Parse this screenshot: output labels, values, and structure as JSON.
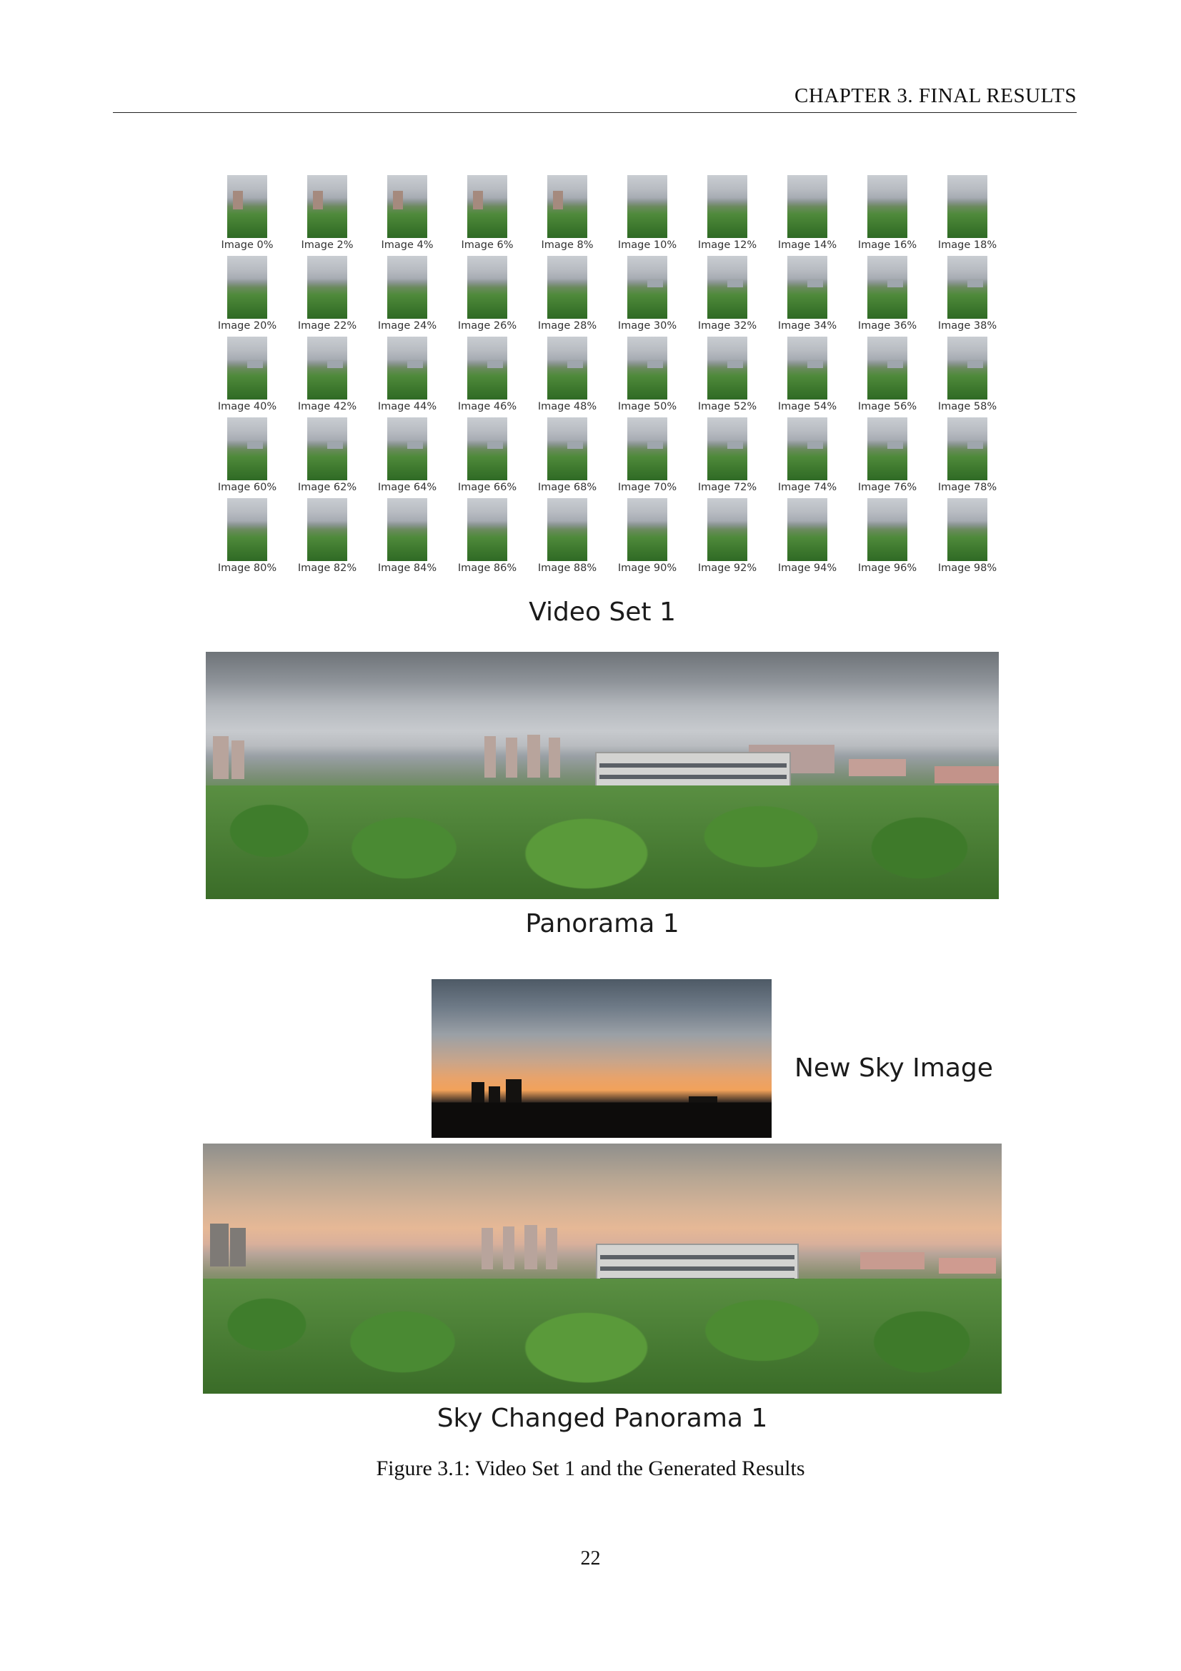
{
  "header": {
    "running_title": "CHAPTER 3.   FINAL RESULTS"
  },
  "figure": {
    "thumbnails": [
      "Image 0%",
      "Image 2%",
      "Image 4%",
      "Image 6%",
      "Image 8%",
      "Image 10%",
      "Image 12%",
      "Image 14%",
      "Image 16%",
      "Image 18%",
      "Image 20%",
      "Image 22%",
      "Image 24%",
      "Image 26%",
      "Image 28%",
      "Image 30%",
      "Image 32%",
      "Image 34%",
      "Image 36%",
      "Image 38%",
      "Image 40%",
      "Image 42%",
      "Image 44%",
      "Image 46%",
      "Image 48%",
      "Image 50%",
      "Image 52%",
      "Image 54%",
      "Image 56%",
      "Image 58%",
      "Image 60%",
      "Image 62%",
      "Image 64%",
      "Image 66%",
      "Image 68%",
      "Image 70%",
      "Image 72%",
      "Image 74%",
      "Image 76%",
      "Image 78%",
      "Image 80%",
      "Image 82%",
      "Image 84%",
      "Image 86%",
      "Image 88%",
      "Image 90%",
      "Image 92%",
      "Image 94%",
      "Image 96%",
      "Image 98%"
    ],
    "video_set_label": "Video Set 1",
    "panorama_label": "Panorama 1",
    "new_sky_label": "New Sky Image",
    "sky_changed_label": "Sky Changed Panorama 1",
    "caption": "Figure 3.1: Video Set 1 and the Generated Results"
  },
  "page_number": "22"
}
